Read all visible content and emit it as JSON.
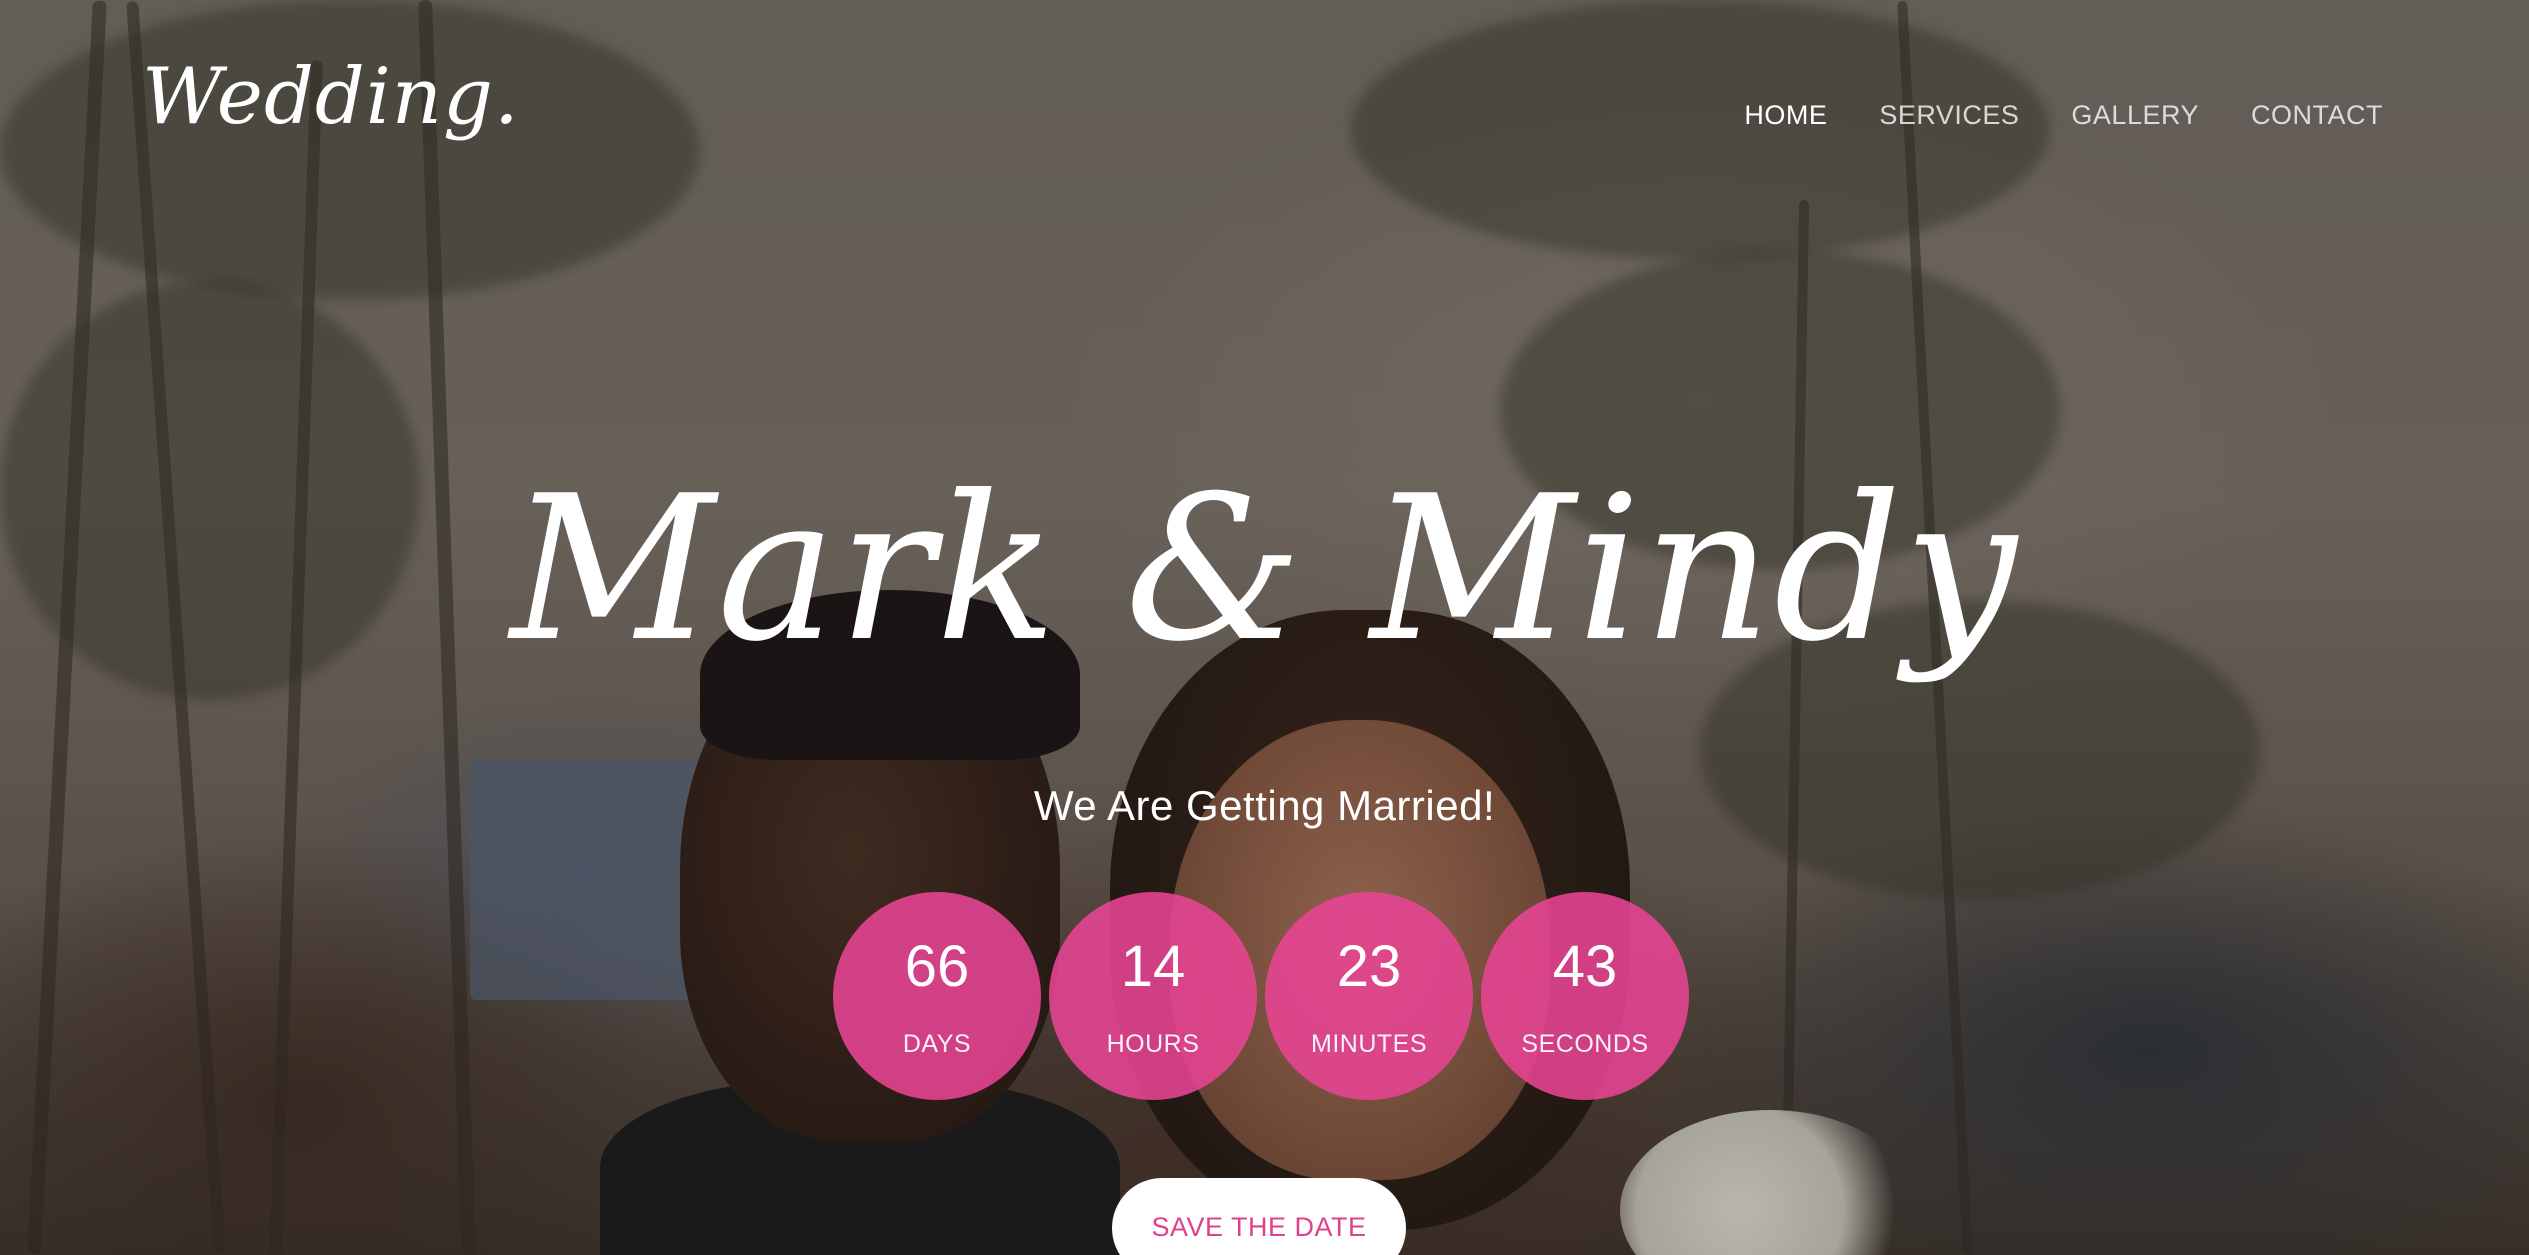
{
  "header": {
    "logo": "Wedding.",
    "nav": [
      {
        "label": "HOME",
        "active": true
      },
      {
        "label": "SERVICES",
        "active": false
      },
      {
        "label": "GALLERY",
        "active": false
      },
      {
        "label": "CONTACT",
        "active": false
      }
    ]
  },
  "hero": {
    "names": "Mark & Mindy",
    "tagline": "We Are Getting Married!",
    "countdown": [
      {
        "value": "66",
        "label": "DAYS"
      },
      {
        "value": "14",
        "label": "HOURS"
      },
      {
        "value": "23",
        "label": "MINUTES"
      },
      {
        "value": "43",
        "label": "SECONDS"
      }
    ],
    "cta_label": "SAVE THE DATE"
  },
  "colors": {
    "accent": "#e8448f",
    "text": "#ffffff"
  }
}
